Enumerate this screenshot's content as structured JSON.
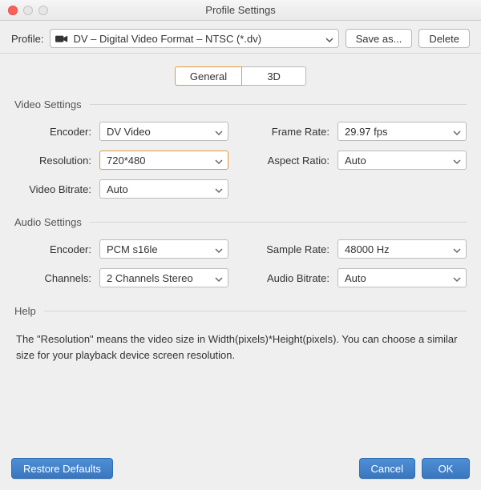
{
  "window": {
    "title": "Profile Settings"
  },
  "toolbar": {
    "profile_label": "Profile:",
    "profile_value": "DV – Digital Video Format – NTSC (*.dv)",
    "save_as_label": "Save as...",
    "delete_label": "Delete"
  },
  "tabs": {
    "general": "General",
    "three_d": "3D"
  },
  "video": {
    "legend": "Video Settings",
    "encoder_label": "Encoder:",
    "encoder_value": "DV Video",
    "frame_rate_label": "Frame Rate:",
    "frame_rate_value": "29.97 fps",
    "resolution_label": "Resolution:",
    "resolution_value": "720*480",
    "aspect_label": "Aspect Ratio:",
    "aspect_value": "Auto",
    "bitrate_label": "Video Bitrate:",
    "bitrate_value": "Auto"
  },
  "audio": {
    "legend": "Audio Settings",
    "encoder_label": "Encoder:",
    "encoder_value": "PCM s16le",
    "sample_label": "Sample Rate:",
    "sample_value": "48000 Hz",
    "channels_label": "Channels:",
    "channels_value": "2 Channels Stereo",
    "bitrate_label": "Audio Bitrate:",
    "bitrate_value": "Auto"
  },
  "help": {
    "legend": "Help",
    "text": "The \"Resolution\" means the video size in Width(pixels)*Height(pixels).  You can choose a similar size for your playback device screen resolution."
  },
  "footer": {
    "restore": "Restore Defaults",
    "cancel": "Cancel",
    "ok": "OK"
  }
}
